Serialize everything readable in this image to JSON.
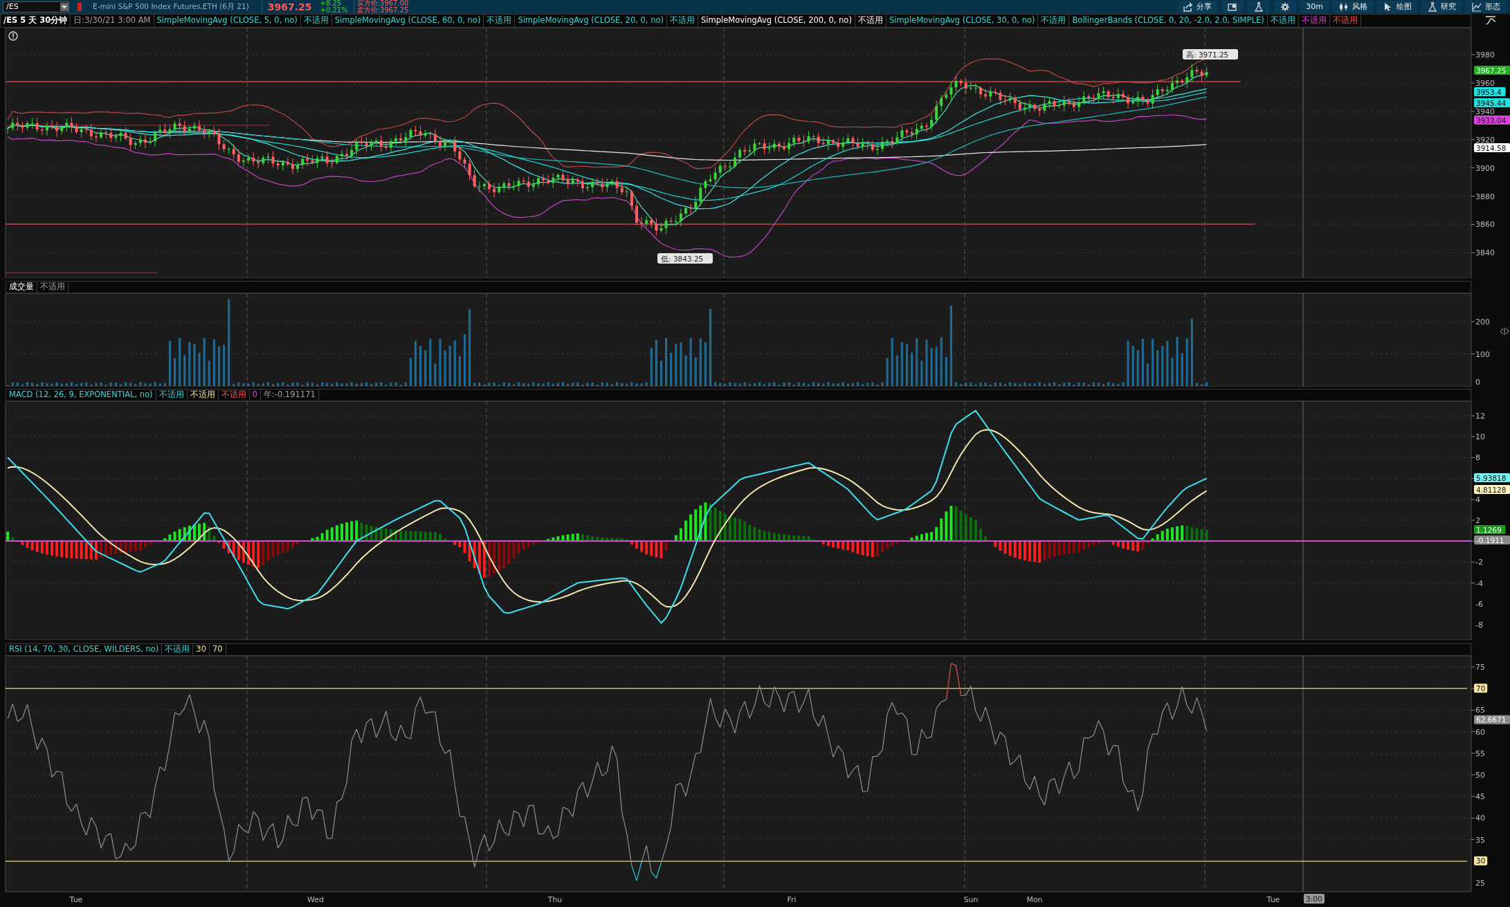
{
  "toolbar": {
    "symbol": "/ES",
    "description": "E-mini S&P 500 Index Futures,ETH (6月 21)",
    "last_price": "3967.25",
    "net_change": "+8.25",
    "percent_change": "+0.21%",
    "bid": "买方价:3967.00",
    "ask": "卖方价:3967.25",
    "buttons": [
      {
        "kind": "share",
        "label": "分享"
      },
      {
        "kind": "news"
      },
      {
        "kind": "flask"
      },
      {
        "kind": "gear"
      },
      {
        "kind": "text",
        "label": "30m"
      },
      {
        "kind": "style",
        "label": "风格"
      },
      {
        "kind": "draw",
        "label": "绘图"
      },
      {
        "kind": "study",
        "label": "研究"
      },
      {
        "kind": "pattern",
        "label": "形态"
      }
    ]
  },
  "study_bar": [
    {
      "label": "/ES 5 天 30分钟"
    },
    {
      "label": "日:3/30/21 3:00 AM"
    },
    {
      "label": "SimpleMovingAvg (CLOSE, 5, 0, no)"
    },
    {
      "label": "不适用"
    },
    {
      "label": "SimpleMovingAvg (CLOSE, 60, 0, no)"
    },
    {
      "label": "不适用"
    },
    {
      "label": "SimpleMovingAvg (CLOSE, 20, 0, no)"
    },
    {
      "label": "不适用"
    },
    {
      "label": "SimpleMovingAvg (CLOSE, 200, 0, no)"
    },
    {
      "label": "不适用"
    },
    {
      "label": "SimpleMovingAvg (CLOSE, 30, 0, no)"
    },
    {
      "label": "不适用"
    },
    {
      "label": "BollingerBands (CLOSE, 0, 20, -2.0, 2.0, SIMPLE)"
    },
    {
      "label": "不适用"
    },
    {
      "label": "不适用"
    },
    {
      "label": "不适用"
    }
  ],
  "price_panel": {
    "axis_labels": [
      "3980",
      "3960",
      "3940",
      "3920",
      "3900",
      "3880",
      "3860",
      "3840"
    ],
    "price_tags": [
      {
        "text": "3967.25",
        "color": "#1fb01f"
      },
      {
        "text": "3953.4",
        "color": "#22e0e0"
      },
      {
        "text": "3945.44",
        "color": "#22e0e0"
      },
      {
        "text": "3933.04",
        "color": "#e040e0"
      },
      {
        "text": "3914.58",
        "color": "#ffffff"
      }
    ],
    "high_label": "高: 3971.25",
    "low_label": "低: 3843.25"
  },
  "volume_panel": {
    "header": [
      {
        "label": "成交量"
      },
      {
        "label": "不适用"
      }
    ],
    "axis_labels": [
      "200",
      "100",
      "0"
    ]
  },
  "macd_panel": {
    "header": [
      {
        "label": "MACD (12, 26, 9, EXPONENTIAL, no)"
      },
      {
        "label": "不适用"
      },
      {
        "label": "不适用"
      },
      {
        "label": "不适用"
      },
      {
        "label": "0"
      },
      {
        "label": "年:-0.191171"
      }
    ],
    "axis_labels": [
      "12",
      "10",
      "8",
      "4",
      "2",
      "-2",
      "-4",
      "-6",
      "-8"
    ],
    "value_tags": [
      {
        "text": "5.93818",
        "color": "#7af0f0"
      },
      {
        "text": "4.81128",
        "color": "#fff3c0"
      },
      {
        "text": "1.1269",
        "color": "#1a9a1a"
      },
      {
        "text": "-0.1911",
        "color": "#8a8a8a"
      }
    ]
  },
  "rsi_panel": {
    "header": [
      {
        "label": "RSI (14, 70, 30, CLOSE, WILDERS, no)"
      },
      {
        "label": "不适用"
      },
      {
        "label": "30"
      },
      {
        "label": "70"
      }
    ],
    "axis_labels": [
      "75",
      "65",
      "60",
      "55",
      "50",
      "45",
      "40",
      "35",
      "25"
    ],
    "value_tags": [
      {
        "text": "70",
        "color": "#f5e6a8"
      },
      {
        "text": "62.6671",
        "color": "#8a8a8a"
      },
      {
        "text": "30",
        "color": "#f5e6a8"
      }
    ]
  },
  "time_axis": {
    "labels": [
      "Tue",
      "Wed",
      "Thu",
      "Fri",
      "Sun",
      "Mon",
      "Tue"
    ],
    "cursor_label": "3:00"
  }
}
